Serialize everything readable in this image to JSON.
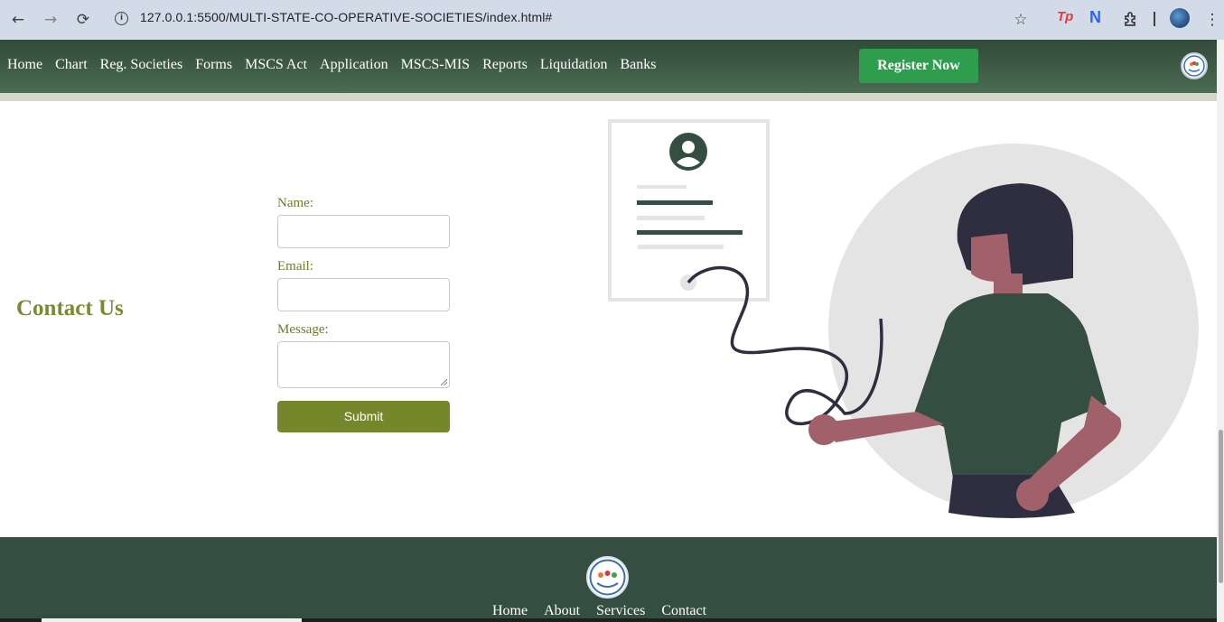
{
  "browser": {
    "url": "127.0.0.1:5500/MULTI-STATE-CO-OPERATIVE-SOCIETIES/index.html#",
    "icons": [
      "back-icon",
      "forward-icon",
      "reload-icon",
      "site-info-icon",
      "bookmark-star-icon",
      "extension-tp-icon",
      "extension-n-icon",
      "extensions-puzzle-icon",
      "profile-avatar",
      "menu-kebab-icon"
    ],
    "ext_tp": "Tp",
    "ext_n": "N"
  },
  "nav": {
    "items": [
      {
        "label": "Home"
      },
      {
        "label": "Chart"
      },
      {
        "label": "Reg. Societies"
      },
      {
        "label": "Forms"
      },
      {
        "label": "MSCS Act"
      },
      {
        "label": "Application"
      },
      {
        "label": "MSCS-MIS"
      },
      {
        "label": "Reports"
      },
      {
        "label": "Liquidation"
      },
      {
        "label": "Banks"
      }
    ],
    "register_label": "Register Now",
    "background": "#3f5c46",
    "register_color": "#2e9d4d"
  },
  "contact": {
    "title": "Contact Us",
    "name_label": "Name:",
    "email_label": "Email:",
    "message_label": "Message:",
    "name_value": "",
    "email_value": "",
    "message_value": "",
    "submit_label": "Submit",
    "accent": "#76862a"
  },
  "footer": {
    "links": [
      {
        "label": "Home"
      },
      {
        "label": "About"
      },
      {
        "label": "Services"
      },
      {
        "label": "Contact"
      }
    ],
    "background": "#344e41"
  }
}
